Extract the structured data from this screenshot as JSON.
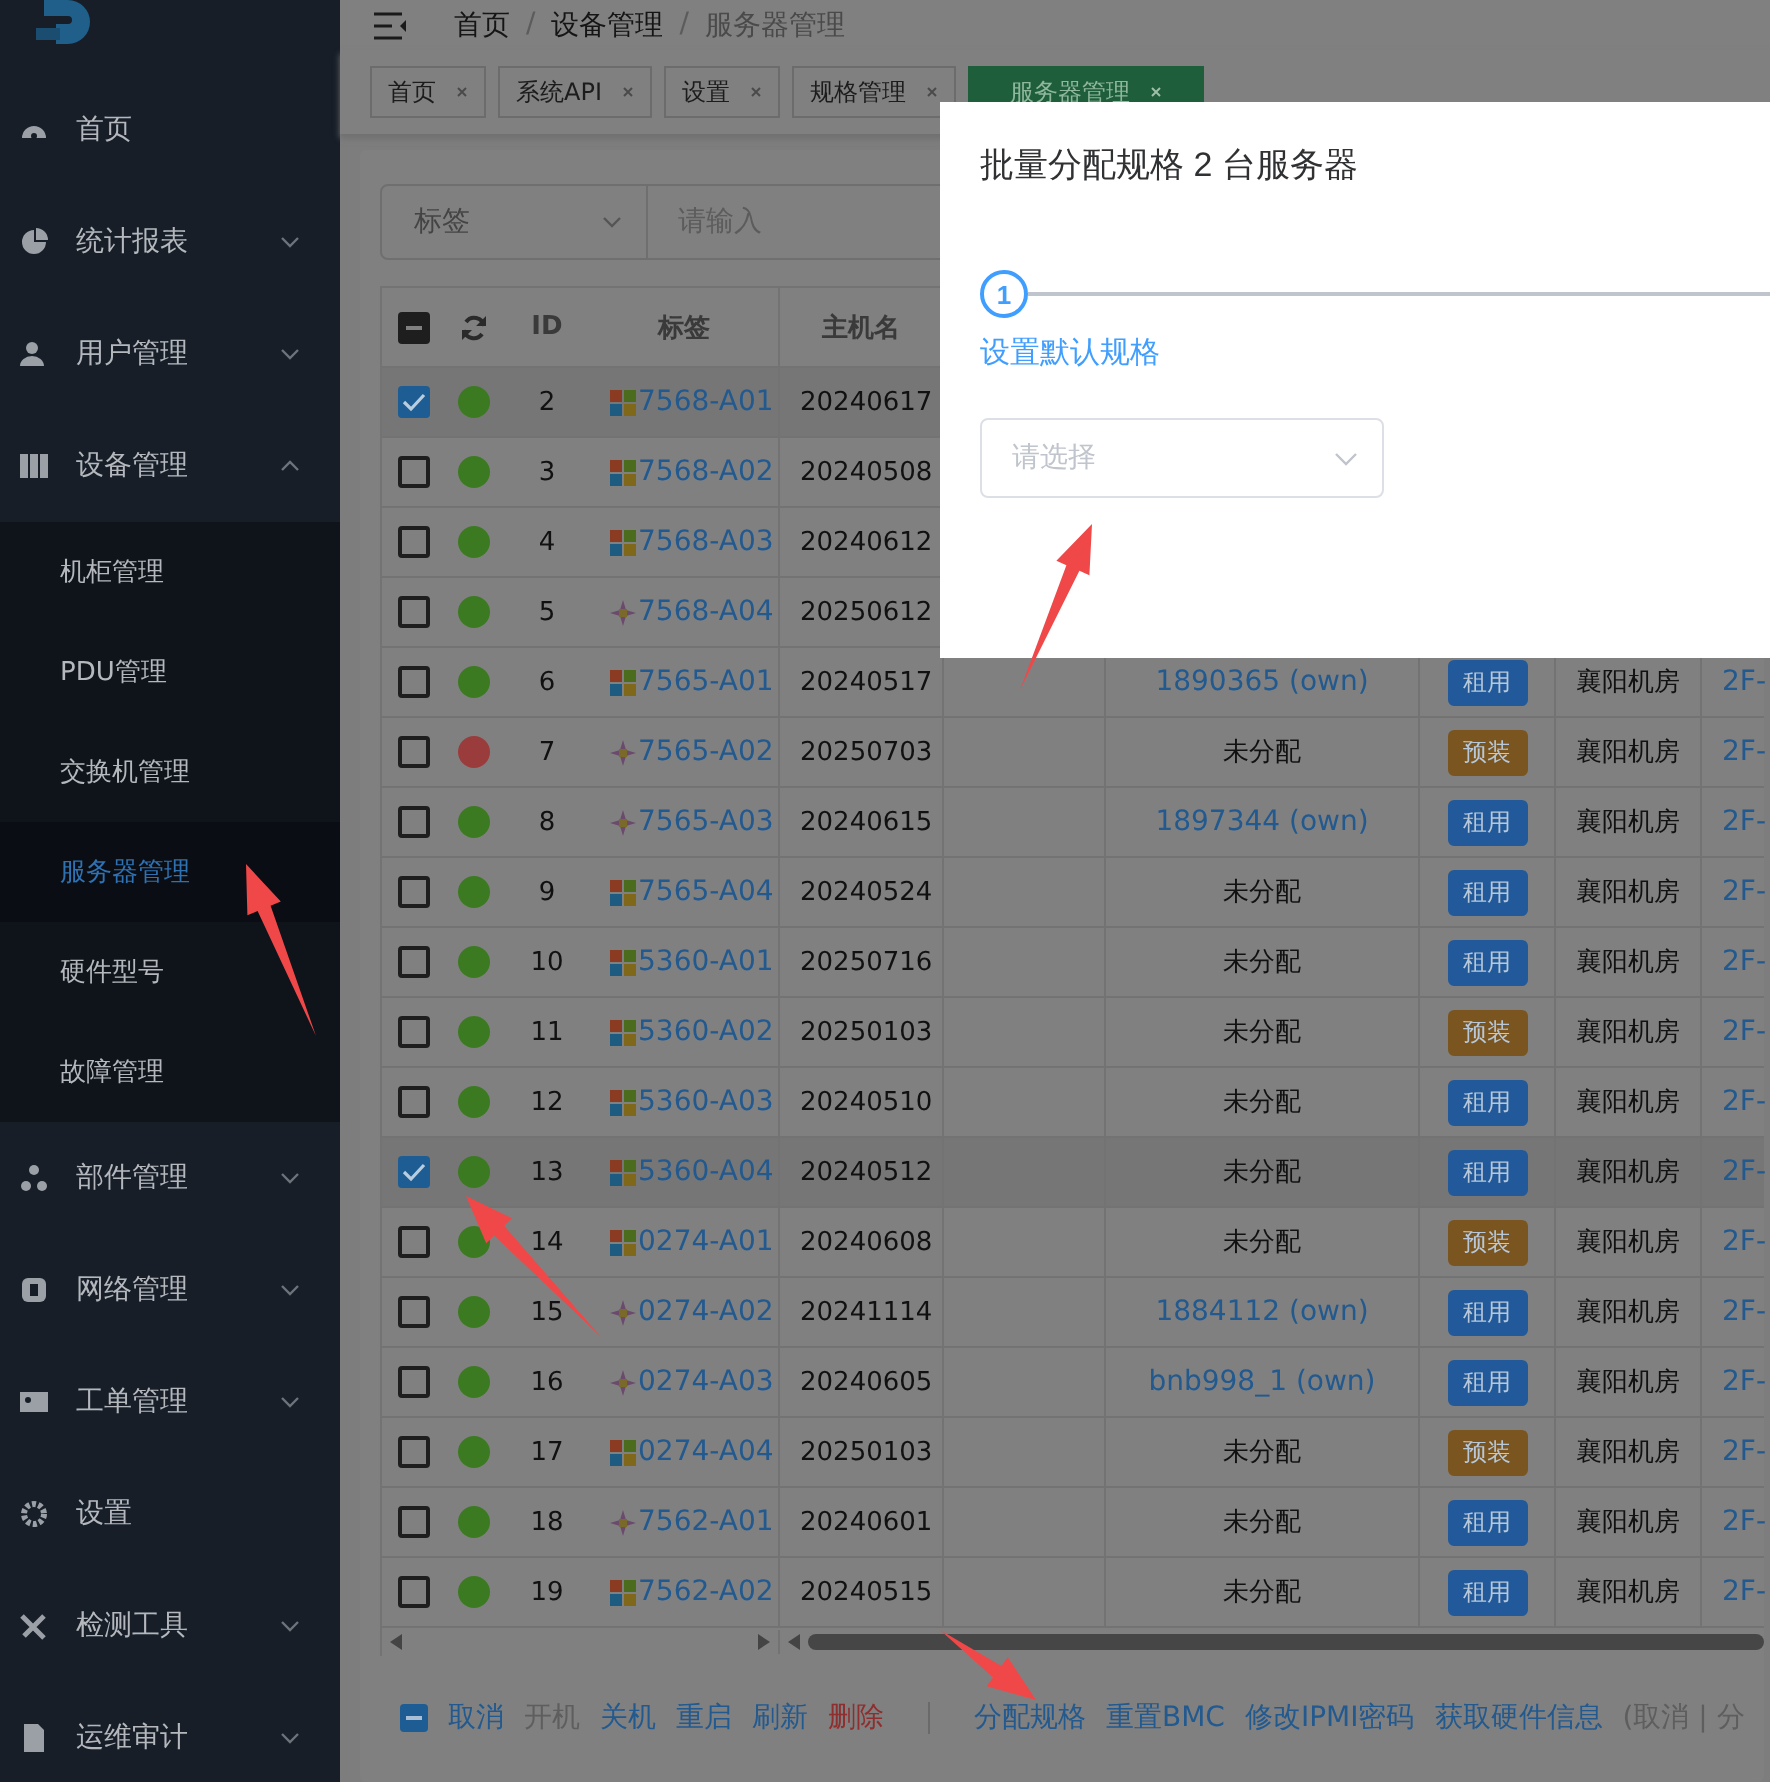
{
  "sidebar": {
    "items": [
      {
        "label": "首页",
        "has_children": false
      },
      {
        "label": "统计报表",
        "has_children": true,
        "expanded": false
      },
      {
        "label": "用户管理",
        "has_children": true,
        "expanded": false
      },
      {
        "label": "设备管理",
        "has_children": true,
        "expanded": true,
        "children": [
          {
            "label": "机柜管理",
            "selected": false
          },
          {
            "label": "PDU管理",
            "selected": false
          },
          {
            "label": "交换机管理",
            "selected": false
          },
          {
            "label": "服务器管理",
            "selected": true
          },
          {
            "label": "硬件型号",
            "selected": false
          },
          {
            "label": "故障管理",
            "selected": false
          }
        ]
      },
      {
        "label": "部件管理",
        "has_children": true,
        "expanded": false
      },
      {
        "label": "网络管理",
        "has_children": true,
        "expanded": false
      },
      {
        "label": "工单管理",
        "has_children": true,
        "expanded": false
      },
      {
        "label": "设置",
        "has_children": false
      },
      {
        "label": "检测工具",
        "has_children": true,
        "expanded": false
      },
      {
        "label": "运维审计",
        "has_children": true,
        "expanded": false
      }
    ]
  },
  "breadcrumb": [
    {
      "label": "首页",
      "kind": "link"
    },
    {
      "label": "/",
      "kind": "separator"
    },
    {
      "label": "设备管理",
      "kind": "link"
    },
    {
      "label": "/",
      "kind": "separator"
    },
    {
      "label": "服务器管理",
      "kind": "current"
    }
  ],
  "tabs": [
    {
      "label": "首页",
      "selected": false
    },
    {
      "label": "系统API",
      "selected": false
    },
    {
      "label": "设置",
      "selected": false
    },
    {
      "label": "规格管理",
      "selected": false
    },
    {
      "label": "服务器管理",
      "selected": true
    }
  ],
  "search": {
    "field": "标签",
    "placeholder": "请输入"
  },
  "table": {
    "header_checkbox": {
      "indeterminate": true
    },
    "columns": [
      "ID",
      "标签",
      "主机名"
    ],
    "rows": [
      {
        "id": "2",
        "selected": true,
        "color": "#3c7a22",
        "kind": "windows",
        "tag": "7568-A01",
        "hostname": "20240617"
      },
      {
        "id": "3",
        "selected": false,
        "color": "#3c7a22",
        "kind": "windows",
        "tag": "7568-A02",
        "hostname": "20240508"
      },
      {
        "id": "4",
        "selected": false,
        "color": "#3c7a22",
        "kind": "windows",
        "tag": "7568-A03",
        "hostname": "20240612"
      },
      {
        "id": "5",
        "selected": false,
        "color": "#3c7a22",
        "kind": "star",
        "tag": "7568-A04",
        "hostname": "20250612"
      },
      {
        "id": "6",
        "selected": false,
        "color": "#3c7a22",
        "kind": "windows",
        "tag": "7565-A01",
        "hostname": "20240517",
        "assignment": {
          "text": "1890365 (own)",
          "kind": "link"
        },
        "type": {
          "text": "租用",
          "color": "#21599a"
        },
        "room": "襄阳机房",
        "column_10": "2F-"
      },
      {
        "id": "7",
        "selected": false,
        "color": "#9a3c3c",
        "kind": "star",
        "tag": "7565-A02",
        "hostname": "20250703",
        "assignment": {
          "text": "未分配",
          "kind": "plain"
        },
        "type": {
          "text": "预装",
          "color": "#7a5520"
        },
        "room": "襄阳机房",
        "column_10": "2F-"
      },
      {
        "id": "8",
        "selected": false,
        "color": "#3c7a22",
        "kind": "star",
        "tag": "7565-A03",
        "hostname": "20240615",
        "assignment": {
          "text": "1897344 (own)",
          "kind": "link"
        },
        "type": {
          "text": "租用",
          "color": "#21599a"
        },
        "room": "襄阳机房",
        "column_10": "2F-"
      },
      {
        "id": "9",
        "selected": false,
        "color": "#3c7a22",
        "kind": "windows",
        "tag": "7565-A04",
        "hostname": "20240524",
        "assignment": {
          "text": "未分配",
          "kind": "plain"
        },
        "type": {
          "text": "租用",
          "color": "#21599a"
        },
        "room": "襄阳机房",
        "column_10": "2F-"
      },
      {
        "id": "10",
        "selected": false,
        "color": "#3c7a22",
        "kind": "windows",
        "tag": "5360-A01",
        "hostname": "20250716",
        "assignment": {
          "text": "未分配",
          "kind": "plain"
        },
        "type": {
          "text": "租用",
          "color": "#21599a"
        },
        "room": "襄阳机房",
        "column_10": "2F-"
      },
      {
        "id": "11",
        "selected": false,
        "color": "#3c7a22",
        "kind": "windows",
        "tag": "5360-A02",
        "hostname": "20250103",
        "assignment": {
          "text": "未分配",
          "kind": "plain"
        },
        "type": {
          "text": "预装",
          "color": "#7a5520"
        },
        "room": "襄阳机房",
        "column_10": "2F-"
      },
      {
        "id": "12",
        "selected": false,
        "color": "#3c7a22",
        "kind": "windows",
        "tag": "5360-A03",
        "hostname": "20240510",
        "assignment": {
          "text": "未分配",
          "kind": "plain"
        },
        "type": {
          "text": "租用",
          "color": "#21599a"
        },
        "room": "襄阳机房",
        "column_10": "2F-"
      },
      {
        "id": "13",
        "selected": true,
        "color": "#3c7a22",
        "kind": "windows",
        "tag": "5360-A04",
        "hostname": "20240512",
        "assignment": {
          "text": "未分配",
          "kind": "plain"
        },
        "type": {
          "text": "租用",
          "color": "#21599a"
        },
        "room": "襄阳机房",
        "column_10": "2F-"
      },
      {
        "id": "14",
        "selected": false,
        "color": "#3c7a22",
        "kind": "windows",
        "tag": "0274-A01",
        "hostname": "20240608",
        "assignment": {
          "text": "未分配",
          "kind": "plain"
        },
        "type": {
          "text": "预装",
          "color": "#7a5520"
        },
        "room": "襄阳机房",
        "column_10": "2F-"
      },
      {
        "id": "15",
        "selected": false,
        "color": "#3c7a22",
        "kind": "star",
        "tag": "0274-A02",
        "hostname": "20241114",
        "assignment": {
          "text": "1884112 (own)",
          "kind": "link"
        },
        "type": {
          "text": "租用",
          "color": "#21599a"
        },
        "room": "襄阳机房",
        "column_10": "2F-"
      },
      {
        "id": "16",
        "selected": false,
        "color": "#3c7a22",
        "kind": "star",
        "tag": "0274-A03",
        "hostname": "20240605",
        "assignment": {
          "text": "bnb998_1 (own)",
          "kind": "link"
        },
        "type": {
          "text": "租用",
          "color": "#21599a"
        },
        "room": "襄阳机房",
        "column_10": "2F-"
      },
      {
        "id": "17",
        "selected": false,
        "color": "#3c7a22",
        "kind": "windows",
        "tag": "0274-A04",
        "hostname": "20250103",
        "assignment": {
          "text": "未分配",
          "kind": "plain"
        },
        "type": {
          "text": "预装",
          "color": "#7a5520"
        },
        "room": "襄阳机房",
        "column_10": "2F-"
      },
      {
        "id": "18",
        "selected": false,
        "color": "#3c7a22",
        "kind": "star",
        "tag": "7562-A01",
        "hostname": "20240601",
        "assignment": {
          "text": "未分配",
          "kind": "plain"
        },
        "type": {
          "text": "租用",
          "color": "#21599a"
        },
        "room": "襄阳机房",
        "column_10": "2F-"
      },
      {
        "id": "19",
        "selected": false,
        "color": "#3c7a22",
        "kind": "windows",
        "tag": "7562-A02",
        "hostname": "20240515",
        "assignment": {
          "text": "未分配",
          "kind": "plain"
        },
        "type": {
          "text": "租用",
          "color": "#21599a"
        },
        "room": "襄阳机房",
        "column_10": "2F-"
      }
    ]
  },
  "bulk_bar": {
    "checkbox": {
      "indeterminate": true
    },
    "groups": [
      [
        {
          "label": "取消",
          "kind": "normal"
        },
        {
          "label": "开机",
          "kind": "disabled"
        },
        {
          "label": "关机",
          "kind": "normal"
        },
        {
          "label": "重启",
          "kind": "normal"
        },
        {
          "label": "刷新",
          "kind": "normal"
        },
        {
          "label": "删除",
          "kind": "danger"
        }
      ],
      [
        {
          "label": "分配规格",
          "kind": "normal"
        },
        {
          "label": "重置BMC",
          "kind": "normal"
        },
        {
          "label": "修改IPMI密码",
          "kind": "normal"
        },
        {
          "label": "获取硬件信息",
          "kind": "normal"
        },
        {
          "label": "(取消 | 分",
          "kind": "disabled"
        }
      ]
    ]
  },
  "modal": {
    "title": "批量分配规格 2 台服务器",
    "steps": [
      {
        "number": "1",
        "label": "设置默认规格",
        "active": true
      }
    ],
    "select": {
      "placeholder": "请选择"
    }
  },
  "annotation_arrows": [
    {
      "kind": "arrow"
    },
    {
      "kind": "arrow"
    },
    {
      "kind": "arrow"
    },
    {
      "kind": "arrow"
    }
  ]
}
